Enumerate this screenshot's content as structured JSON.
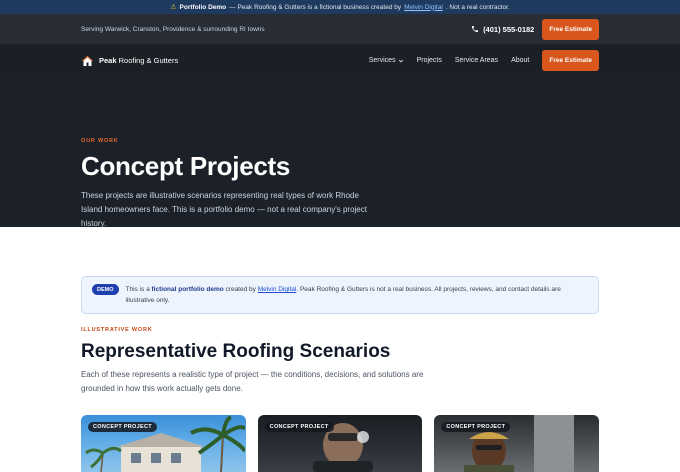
{
  "demo_banner": {
    "bold": "Portfolio Demo",
    "text_before_link": " — Peak Roofing & Gutters is a fictional business created by ",
    "link": "Melvin Digital",
    "text_after_link": ". Not a real contractor."
  },
  "topbar": {
    "service_area": "Serving Warwick, Cranston, Providence & surrounding RI towns",
    "phone": "(401) 555-0182",
    "cta": "Free Estimate"
  },
  "nav": {
    "brand_bold": "Peak",
    "brand_rest": " Roofing & Gutters",
    "links": [
      "Services",
      "Projects",
      "Service Areas",
      "About"
    ],
    "cta": "Free Estimate"
  },
  "hero": {
    "eyebrow": "OUR WORK",
    "title": "Concept Projects",
    "description": "These projects are illustrative scenarios representing real types of work Rhode Island homeowners face. This is a portfolio demo — not a real company's project history."
  },
  "notice": {
    "badge": "DEMO",
    "text_1": "This is a ",
    "bold": "fictional portfolio demo",
    "text_2": " created by ",
    "link": "Melvin Digital",
    "text_3": ". Peak Roofing & Gutters is not a real business. All projects, reviews, and contact details are illustrative only."
  },
  "section": {
    "eyebrow": "ILLUSTRATIVE WORK",
    "title": "Representative Roofing Scenarios",
    "description": "Each of these represents a realistic type of project — the conditions, decisions, and solutions are grounded in how this work actually gets done."
  },
  "cards": [
    {
      "badge": "CONCEPT PROJECT"
    },
    {
      "badge": "CONCEPT PROJECT"
    },
    {
      "badge": "CONCEPT PROJECT"
    }
  ],
  "colors": {
    "accent": "#d9561d",
    "banner": "#1e3a5f",
    "hero_bg": "#1c2028",
    "demo_badge": "#1e40af"
  }
}
